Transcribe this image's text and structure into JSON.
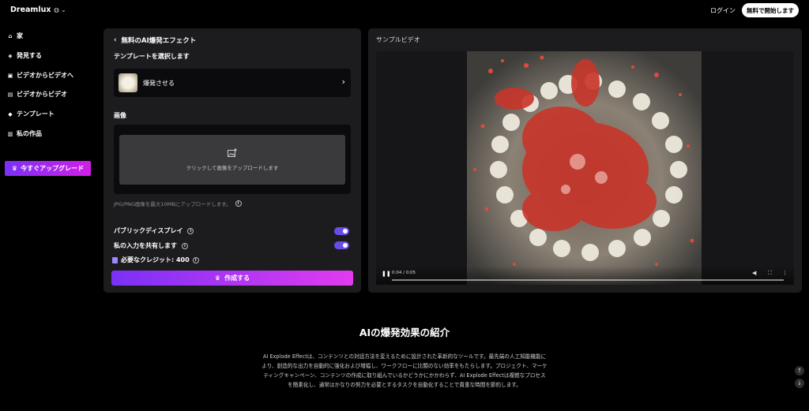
{
  "header": {
    "logo": "Dreamlux",
    "language_icon": "globe-icon",
    "login": "ログイン",
    "start_button": "無料で開始します"
  },
  "sidebar": {
    "items": [
      {
        "label": "家",
        "icon": "home-icon"
      },
      {
        "label": "発見する",
        "icon": "compass-icon"
      },
      {
        "label": "ビデオからビデオへ",
        "icon": "video-icon"
      },
      {
        "label": "ビデオからビデオ",
        "icon": "film-icon"
      },
      {
        "label": "テンプレート",
        "icon": "template-icon"
      },
      {
        "label": "私の作品",
        "icon": "folder-icon"
      }
    ],
    "upgrade_button": "今すぐアップグレード"
  },
  "generator": {
    "back_title": "無料のAI爆発エフェクト",
    "template_label": "テンプレートを選択します",
    "selected_template": "爆発させる",
    "image_label": "画像",
    "upload_text": "クリックして画像をアップロードします",
    "upload_note": "JPG/PNG画像を最大10MBにアップロードします。",
    "public_display": "パブリックディスプレイ",
    "share_input": "私の入力を共有します",
    "credits_label": "必要なクレジット: 400",
    "create_button": "作成する"
  },
  "sample": {
    "title": "サンプルビデオ",
    "time": "0:04 / 0:05"
  },
  "intro": {
    "title": "AIの爆発効果の紹介",
    "body": "AI Explode Effectは、コンテンツとの対話方法を変えるために設計された革新的なツールです。最先端の人工知能機能により、創造的な出力を自動的に強化および増幅し、ワークフローに比類のない効率をもたらします。プロジェクト、マーケティングキャンペーン、コンテンツの作成に取り組んでいるかどうかにかかわらず、AI Explode Effectは複雑なプロセスを簡素化し、通常はかなりの努力を必要とするタスクを自動化することで貴重な時間を節約します。"
  },
  "colors": {
    "accent_start": "#7a31f5",
    "accent_end": "#e23bf0",
    "panel": "#1c1c1f"
  }
}
